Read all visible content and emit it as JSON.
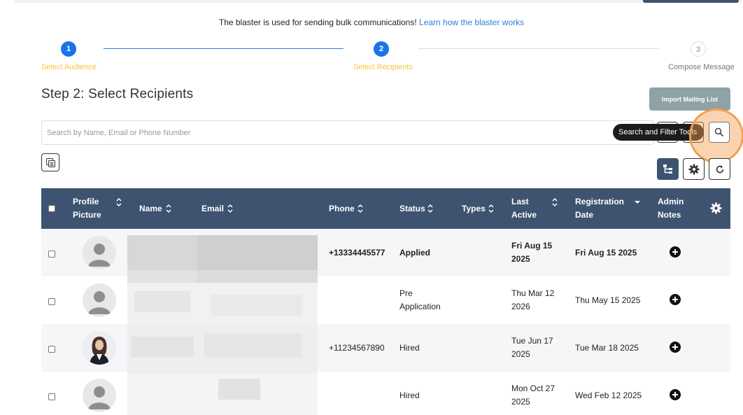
{
  "intro": {
    "text": "The blaster is used for sending bulk communications!",
    "link": "Learn how the blaster works"
  },
  "steps": [
    {
      "number": "1",
      "label": "Select Audience"
    },
    {
      "number": "2",
      "label": "Select Recipients"
    },
    {
      "number": "3",
      "label": "Compose Message"
    }
  ],
  "page_title": "Step 2: Select Recipients",
  "import_button": "Import Mailing List",
  "search": {
    "placeholder": "Search by Name, Email or Phone Number"
  },
  "tooltip": "Search and Filter Tools",
  "columns": {
    "profile": [
      "Profile",
      "Picture"
    ],
    "name": "Name",
    "email": "Email",
    "phone": "Phone",
    "status": "Status",
    "types": "Types",
    "last_active": [
      "Last",
      "Active"
    ],
    "registration": [
      "Registration",
      "Date"
    ],
    "admin_notes": [
      "Admin",
      "Notes"
    ]
  },
  "rows": [
    {
      "phone": "+13334445577",
      "status": [
        "Applied"
      ],
      "last_active": [
        "Fri Aug 15",
        "2025"
      ],
      "registration": "Fri Aug 15 2025",
      "bold": true,
      "avatar": "placeholder-avatar"
    },
    {
      "phone": "",
      "status": [
        "Pre",
        "Application"
      ],
      "last_active": [
        "Thu Mar 12",
        "2026"
      ],
      "registration": "Thu May 15 2025",
      "bold": false,
      "avatar": "placeholder-avatar"
    },
    {
      "phone": "+11234567890",
      "status": [
        "Hired"
      ],
      "last_active": [
        "Tue Jun 17",
        "2025"
      ],
      "registration": "Tue Mar 18 2025",
      "bold": false,
      "avatar": "photo-avatar"
    },
    {
      "phone": "",
      "status": [
        "Hired"
      ],
      "last_active": [
        "Mon Oct 27",
        "2025"
      ],
      "registration": "Wed Feb 12 2025",
      "bold": false,
      "avatar": "placeholder-avatar"
    }
  ],
  "colors": {
    "header": "#3d5370",
    "accent": "#1a73e8",
    "step_label": "#f5c542",
    "highlight": "#f2a04e"
  }
}
